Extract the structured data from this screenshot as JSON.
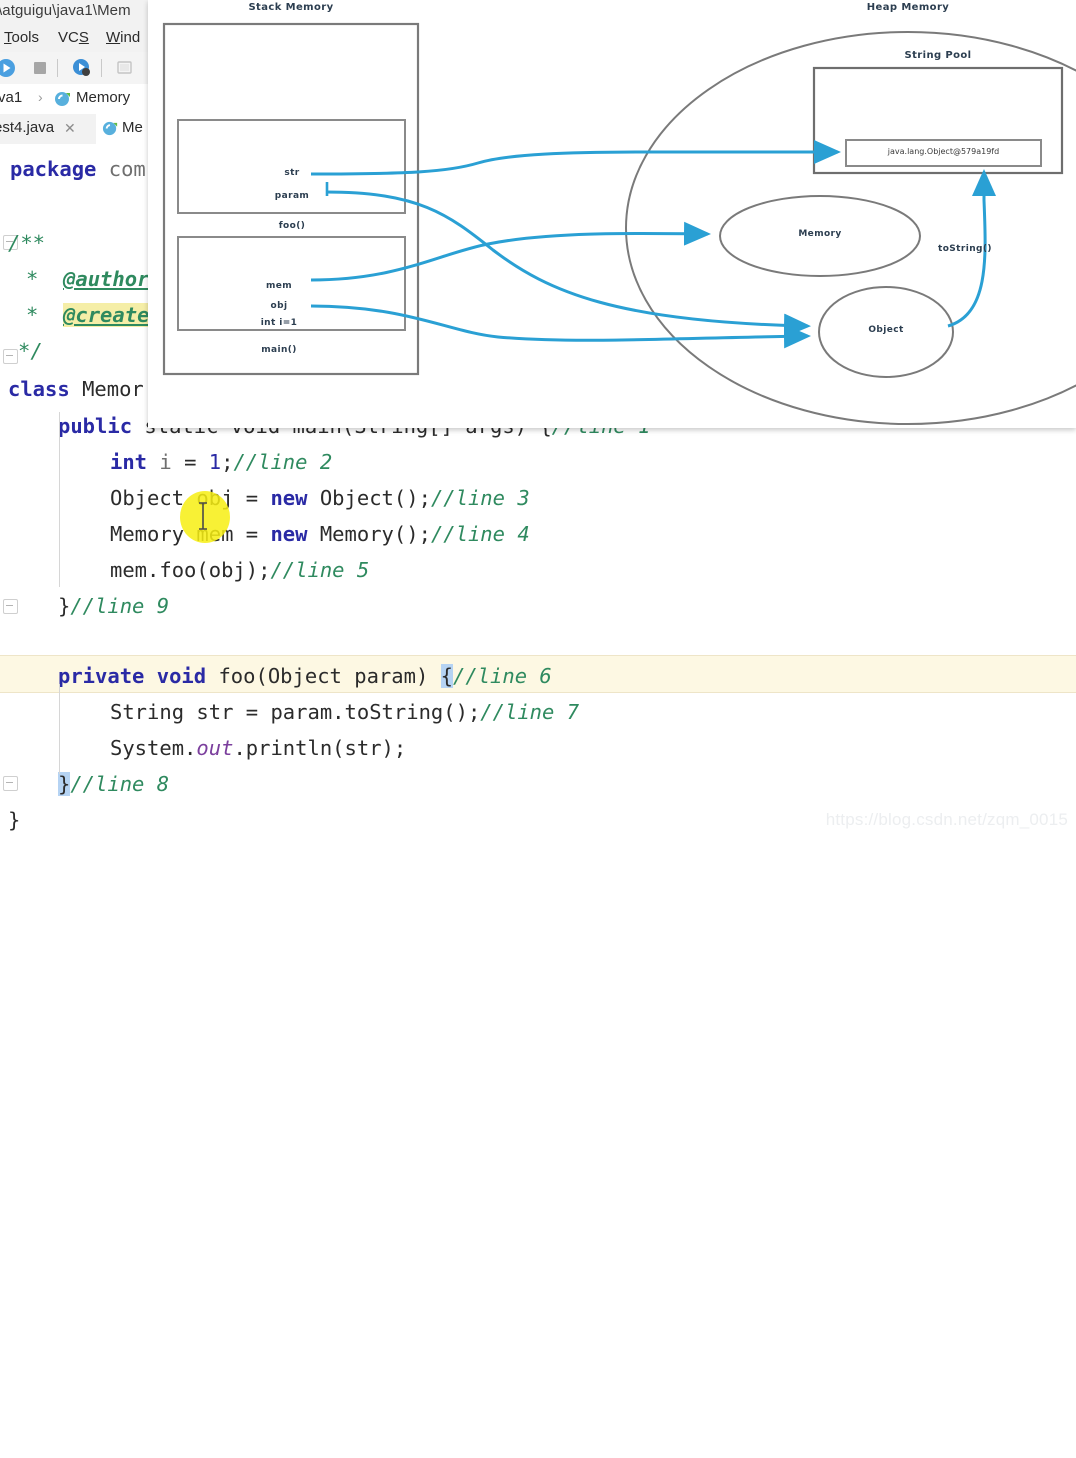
{
  "ide": {
    "title_path": "\\atguigu\\java1\\Mem",
    "menus": [
      {
        "label": "Tools",
        "accel": "T"
      },
      {
        "label": "VCS",
        "accel": "S"
      },
      {
        "label": "Wind",
        "accel": "W"
      }
    ],
    "toolbar_icons": [
      "run-icon",
      "stop-icon",
      "debug-icon",
      "screenshot-icon"
    ],
    "breadcrumb": {
      "module": "va1",
      "separator": "›",
      "class_icon": "java-class-icon",
      "class_name": "Memory"
    },
    "tabs": [
      {
        "label": "est4.java",
        "active": false,
        "closable": true,
        "icon": ""
      },
      {
        "label": "Me",
        "active": true,
        "closable": false,
        "icon": "java-class-icon"
      }
    ]
  },
  "code": {
    "lines": [
      {
        "id": "l-package",
        "text": "package com"
      },
      {
        "id": "l-blank1",
        "text": ""
      },
      {
        "id": "l-doc-open",
        "text": "/**"
      },
      {
        "id": "l-author",
        "text": " * @author"
      },
      {
        "id": "l-create",
        "text": " * @create"
      },
      {
        "id": "l-doc-close",
        "text": " */"
      },
      {
        "id": "l-class",
        "text": "class Memor"
      },
      {
        "id": "l-main",
        "text": "    public static void main(String[] args) {//line 1"
      },
      {
        "id": "l-2",
        "text": "        int i = 1;//line 2"
      },
      {
        "id": "l-3",
        "text": "        Object obj = new Object();//line 3"
      },
      {
        "id": "l-4",
        "text": "        Memory mem = new Memory();//line 4"
      },
      {
        "id": "l-5",
        "text": "        mem.foo(obj);//line 5"
      },
      {
        "id": "l-9",
        "text": "    }//line 9"
      },
      {
        "id": "l-blank2",
        "text": ""
      },
      {
        "id": "l-foo",
        "text": "    private void foo(Object param) {//line 6"
      },
      {
        "id": "l-7",
        "text": "        String str = param.toString();//line 7"
      },
      {
        "id": "l-print",
        "text": "        System.out.println(str);"
      },
      {
        "id": "l-8",
        "text": "    }//line 8"
      },
      {
        "id": "l-end",
        "text": "}"
      }
    ],
    "tokens": {
      "kw_package": "package",
      "pkg_name": "com",
      "doc_open": "/**",
      "doc_star": "*",
      "doc_close": "*/",
      "tag_author": "@author",
      "tag_create": "@create",
      "kw_class": "class",
      "class_name": "Memor",
      "kw_public": "public",
      "rest_main": "static void main(String[] args) {",
      "cmt_line1": "//line 1",
      "kw_int": "int",
      "var_i": "i",
      "eq": "=",
      "one": "1",
      "semi": ";",
      "cmt_line2": "//line 2",
      "type_object": "Object",
      "var_obj": "obj",
      "kw_new": "new",
      "ctor_object": "Object();",
      "cmt_line3": "//line 3",
      "type_memory": "Memory",
      "var_mem": "mem",
      "ctor_memory": "Memory();",
      "cmt_line4": "//line 4",
      "call_foo": "mem.foo(obj);",
      "cmt_line5": "//line 5",
      "brace_close": "}",
      "cmt_line9": "//line 9",
      "kw_private": "private",
      "kw_void": "void",
      "sig_foo": "foo(Object param) ",
      "brace_open": "{",
      "cmt_line6": "//line 6",
      "type_string": "String",
      "var_str": "str",
      "expr_tostring": "param.toString();",
      "cmt_line7": "//line 7",
      "sys": "System.",
      "out": "out",
      "println": ".println(str);",
      "cmt_line8": "//line 8"
    },
    "watermark": "https://blog.csdn.net/zqm_0015"
  },
  "diagram": {
    "stack_title": "Stack Memory",
    "heap_title": "Heap Memory",
    "string_pool_title": "String Pool",
    "string_literal": "java.lang.Object@579a19fd",
    "frames": [
      {
        "name": "foo()",
        "vars": [
          "str",
          "param"
        ]
      },
      {
        "name": "main()",
        "vars": [
          "mem",
          "obj",
          "int i=1"
        ]
      }
    ],
    "heap_objects": [
      "Memory",
      "Object"
    ],
    "edge_label_tostring": "toString()",
    "arrow_color": "#2aa0d4",
    "box_color": "#7a7a7a",
    "text_color": "#2c3e50"
  }
}
